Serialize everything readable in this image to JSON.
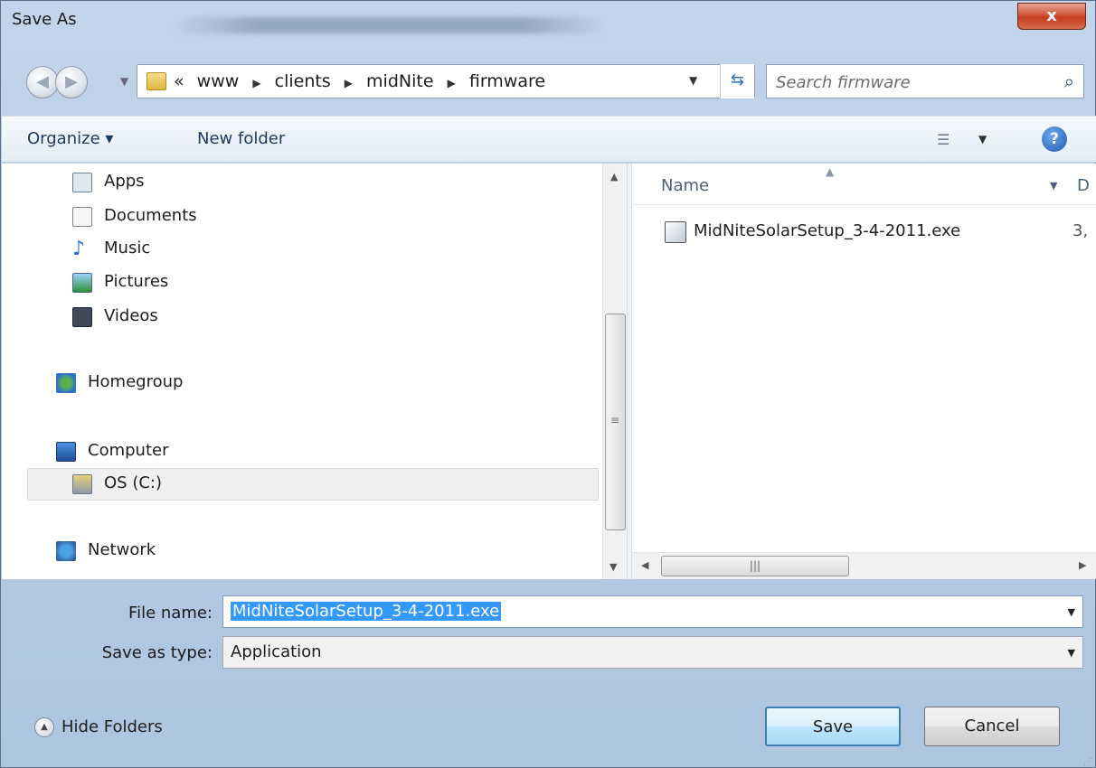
{
  "window": {
    "title": "Save As",
    "close_label": "x"
  },
  "address": {
    "crumbs_prefix": "«",
    "crumbs": [
      "www",
      "clients",
      "midNite",
      "firmware"
    ],
    "search_placeholder": "Search firmware"
  },
  "toolbar": {
    "organize_label": "Organize ▾",
    "new_folder_label": "New folder",
    "help_label": "?"
  },
  "nav_pane": {
    "items": [
      {
        "label": "Apps",
        "icon": "apps-icon"
      },
      {
        "label": "Documents",
        "icon": "documents-icon"
      },
      {
        "label": "Music",
        "icon": "music-icon"
      },
      {
        "label": "Pictures",
        "icon": "pictures-icon"
      },
      {
        "label": "Videos",
        "icon": "videos-icon"
      },
      {
        "label": "Homegroup",
        "icon": "homegroup-icon"
      },
      {
        "label": "Computer",
        "icon": "computer-icon"
      },
      {
        "label": "OS (C:)",
        "icon": "drive-icon",
        "selected": true
      },
      {
        "label": "Network",
        "icon": "network-icon"
      }
    ]
  },
  "file_list": {
    "columns": [
      "Name",
      "D"
    ],
    "files": [
      {
        "name": "MidNiteSolarSetup_3-4-2011.exe",
        "date_fragment": "3,"
      }
    ]
  },
  "form": {
    "file_name_label": "File name:",
    "file_name_value": "MidNiteSolarSetup_3-4-2011.exe",
    "save_type_label": "Save as type:",
    "save_type_value": "Application"
  },
  "footer": {
    "hide_folders_label": "Hide Folders",
    "save_label": "Save",
    "cancel_label": "Cancel"
  },
  "colors": {
    "selection": "#3399ff",
    "close_button": "#c43d20",
    "save_border": "#3c7fb1"
  }
}
